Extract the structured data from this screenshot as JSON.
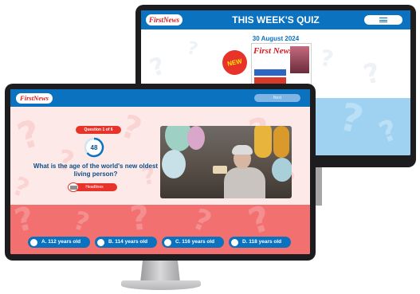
{
  "back_screen": {
    "logo": "FirstNews",
    "title": "THIS WEEK'S QUIZ",
    "menu_icon": "hamburger-icon",
    "date": "30 August 2024",
    "badge": "NEW",
    "magazine_logo": "First News"
  },
  "front_screen": {
    "logo": "FirstNews",
    "next_label": "Next",
    "question_badge": "Question 1 of 6",
    "timer_value": "48",
    "question": "What is the age of the world's new oldest living person?",
    "headlines_label": "Headlines",
    "photo_alt": "Elderly woman celebrating birthday with balloons",
    "answers": [
      {
        "label": "A. 112 years old"
      },
      {
        "label": "B. 114 years old"
      },
      {
        "label": "C. 116 years old"
      },
      {
        "label": "D. 118 years old"
      }
    ]
  },
  "colors": {
    "brand_blue": "#0a72bf",
    "brand_red": "#e7332a",
    "answer_area": "#f27070",
    "light_blue": "#9fd2f1"
  }
}
